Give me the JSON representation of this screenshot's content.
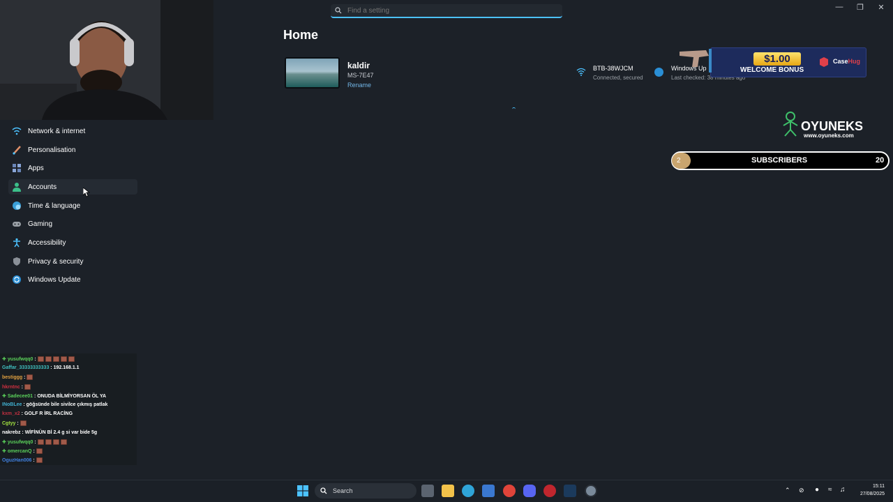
{
  "window": {
    "controls": [
      "minimize",
      "restore",
      "close"
    ]
  },
  "search": {
    "placeholder": "Find a setting",
    "value": ""
  },
  "main": {
    "title": "Home",
    "device": {
      "name": "kaldir",
      "model": "MS-7E47",
      "rename_label": "Rename"
    },
    "network": {
      "ssid": "BTB-38WJCM",
      "status": "Connected, secured"
    },
    "windows_update": {
      "title": "Windows Up",
      "status": "Last checked: 38 minutes ago"
    }
  },
  "sidebar": {
    "items": [
      {
        "label": "Network & internet",
        "icon": "wifi-icon"
      },
      {
        "label": "Personalisation",
        "icon": "brush-icon"
      },
      {
        "label": "Apps",
        "icon": "apps-icon"
      },
      {
        "label": "Accounts",
        "icon": "person-icon"
      },
      {
        "label": "Time & language",
        "icon": "globe-clock-icon"
      },
      {
        "label": "Gaming",
        "icon": "gamepad-icon"
      },
      {
        "label": "Accessibility",
        "icon": "accessibility-icon"
      },
      {
        "label": "Privacy & security",
        "icon": "shield-icon"
      },
      {
        "label": "Windows Update",
        "icon": "update-icon"
      }
    ]
  },
  "overlay": {
    "ad": {
      "amount": "$1.00",
      "text": "WELCOME BONUS",
      "brand_case": "Case",
      "brand_hug": "Hug"
    },
    "brand": {
      "name": "OYUNEKS",
      "url": "www.oyuneks.com"
    },
    "subscribers": {
      "current": "2",
      "label": "SUBSCRIBERS",
      "goal": "20",
      "progress": 0.1
    }
  },
  "chat": {
    "messages": [
      {
        "user": "yusufwqq0",
        "color": "#5ad05a",
        "plus": true,
        "text": "",
        "emotes": 5
      },
      {
        "user": "Gaffar_33333333333",
        "color": "#40c0c0",
        "plus": false,
        "text": "192.168.1.1",
        "emotes": 0
      },
      {
        "user": "bestiggg",
        "color": "#e0a040",
        "plus": false,
        "text": "",
        "emotes": 1
      },
      {
        "user": "hkrntnc",
        "color": "#d03040",
        "plus": false,
        "text": "",
        "emotes": 1
      },
      {
        "user": "Sadecee01",
        "color": "#5ad05a",
        "plus": true,
        "text": "ONUDA BİLMİYORSAN ÖL YA",
        "emotes": 0
      },
      {
        "user": "INoBLee",
        "color": "#40b0d0",
        "plus": false,
        "text": "göğsünde bile sivilce çıkmış patlak",
        "emotes": 0
      },
      {
        "user": "kxm_x2",
        "color": "#c03040",
        "plus": false,
        "text": "GOLF R İRL RACİNG",
        "emotes": 0
      },
      {
        "user": "Cgtyy",
        "color": "#a0e040",
        "plus": false,
        "text": "",
        "emotes": 1
      },
      {
        "user": "nakrebz",
        "color": "#ffffff",
        "plus": false,
        "text": "WİFİNÜN Bİ 2.4 g si var bide 5g",
        "emotes": 0
      },
      {
        "user": "yusufwqq0",
        "color": "#5ad05a",
        "plus": true,
        "text": "",
        "emotes": 4
      },
      {
        "user": "omercanQ",
        "color": "#5ad05a",
        "plus": true,
        "text": "",
        "emotes": 1
      },
      {
        "user": "OguzHan006",
        "color": "#4080e0",
        "plus": false,
        "text": "",
        "emotes": 1
      }
    ]
  },
  "taskbar": {
    "search_label": "Search",
    "time": "15:11",
    "date": "27/08/2025",
    "apps": [
      "task-view-icon",
      "file-explorer-icon",
      "edge-icon",
      "store-icon",
      "chrome-icon",
      "discord-icon",
      "opera-icon",
      "steam-icon",
      "settings-icon"
    ]
  },
  "colors": {
    "background": "#1c2128",
    "accent": "#4cc2ff",
    "link": "#72b7e8"
  }
}
